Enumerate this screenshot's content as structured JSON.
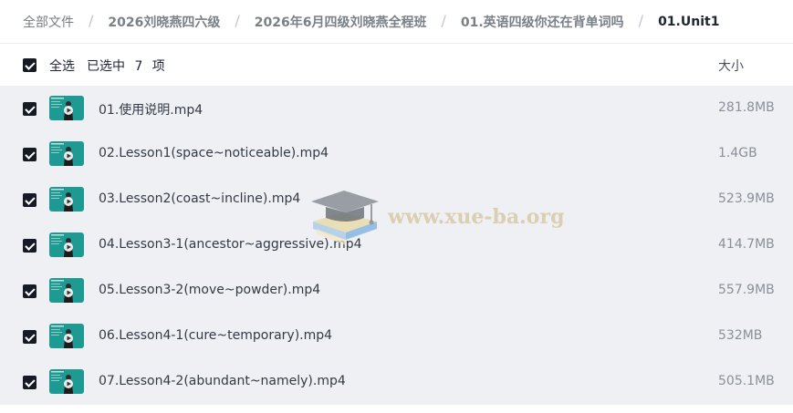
{
  "breadcrumb": {
    "items": [
      {
        "label": "全部文件"
      },
      {
        "label": "2026刘晓燕四六级"
      },
      {
        "label": "2026年6月四级刘晓燕全程班"
      },
      {
        "label": "01.英语四级你还在背单词吗"
      },
      {
        "label": "01.Unit1"
      }
    ],
    "separator": "/"
  },
  "header": {
    "select_all_label": "全选",
    "selected_text": "已选中 7 项",
    "size_column_label": "大小"
  },
  "files": [
    {
      "name": "01.使用说明.mp4",
      "size": "281.8MB",
      "checked": true,
      "icon": "video-thumbnail-icon"
    },
    {
      "name": "02.Lesson1(space~noticeable).mp4",
      "size": "1.4GB",
      "checked": true,
      "icon": "video-thumbnail-icon"
    },
    {
      "name": "03.Lesson2(coast~incline).mp4",
      "size": "523.9MB",
      "checked": true,
      "icon": "video-thumbnail-icon"
    },
    {
      "name": "04.Lesson3-1(ancestor~aggressive).mp4",
      "size": "414.7MB",
      "checked": true,
      "icon": "video-thumbnail-icon"
    },
    {
      "name": "05.Lesson3-2(move~powder).mp4",
      "size": "557.9MB",
      "checked": true,
      "icon": "video-thumbnail-icon"
    },
    {
      "name": "06.Lesson4-1(cure~temporary).mp4",
      "size": "532MB",
      "checked": true,
      "icon": "video-thumbnail-icon"
    },
    {
      "name": "07.Lesson4-2(abundant~namely).mp4",
      "size": "505.1MB",
      "checked": true,
      "icon": "video-thumbnail-icon"
    }
  ],
  "watermark": {
    "text": "www.xue-ba.org",
    "icon": "graduation-cap-icon"
  },
  "colors": {
    "accent_dark": "#151a25",
    "list_background": "#eef0f4",
    "thumbnail_teal": "#1f9a93",
    "watermark_text": "#d9c9a6"
  }
}
